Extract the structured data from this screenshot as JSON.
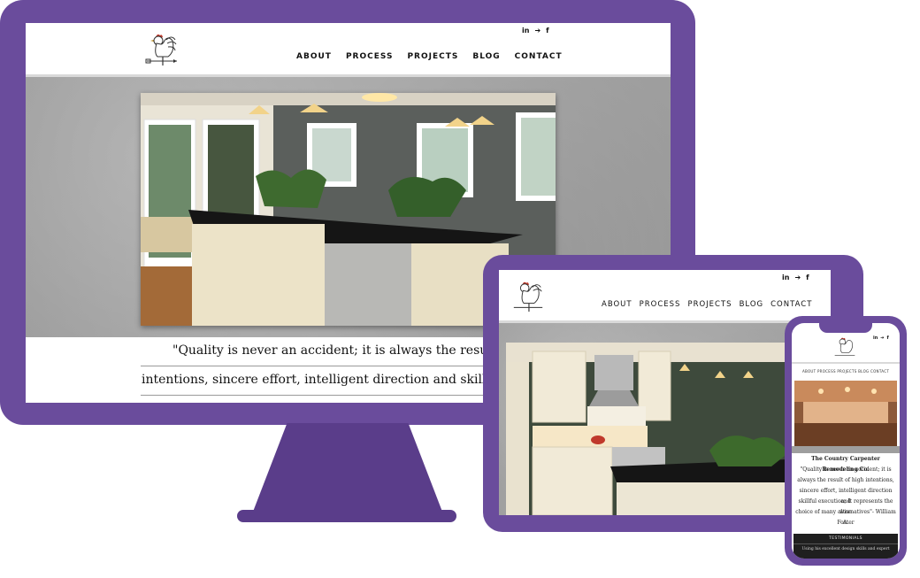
{
  "brand": {
    "accent": "#6a4c9c",
    "logo": "rooster-weathervane-icon"
  },
  "social": {
    "linkedin": "in",
    "twitter": "➔",
    "facebook": "f"
  },
  "nav": [
    "ABOUT",
    "PROCESS",
    "PROJECTS",
    "BLOG",
    "CONTACT"
  ],
  "desktop": {
    "hero": "kitchen-island-photo",
    "quote_line1": "\"Quality is never an accident; it is always the result",
    "quote_line2": "intentions, sincere effort, intelligent direction and skillfu"
  },
  "tablet": {
    "hero": "white-kitchen-photo"
  },
  "phone": {
    "nav": "ABOUT PROCESS PROJECTS BLOG CONTACT",
    "company": "The Country Carpenter Remodeling Co.",
    "quote": [
      "\"Quality is never an accident; it is",
      "always the result of high intentions,",
      "sincere effort, intelligent direction and",
      "skillful execution; It represents the wise",
      "choice of many alternatives\"- William A.",
      "Foster"
    ],
    "testimonials_label": "TESTIMONIALS",
    "teaser": "Using his excellent design skills and expert"
  }
}
